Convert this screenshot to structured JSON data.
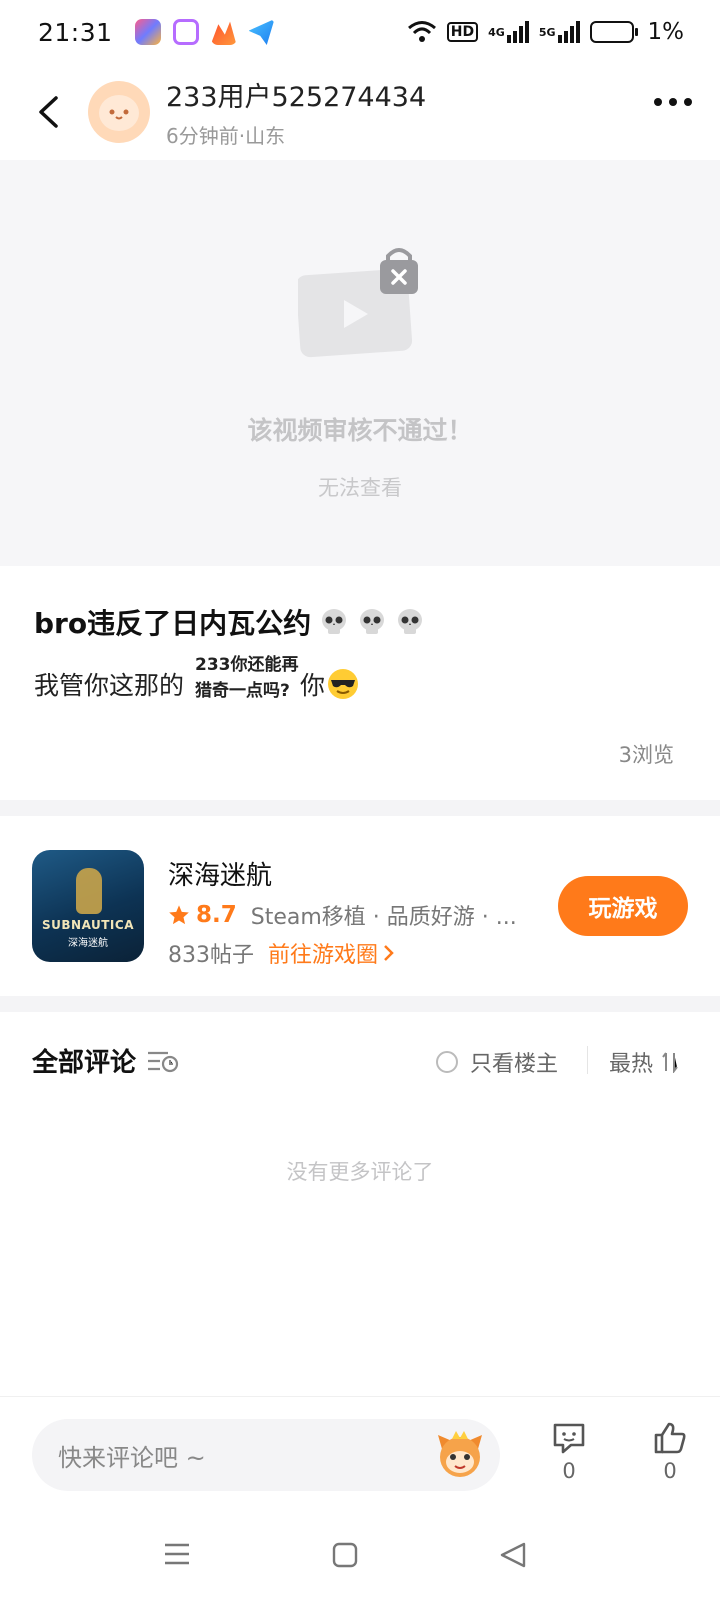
{
  "status_bar": {
    "time": "21:31",
    "battery_text": "1%",
    "app_icons": [
      "app-icon-1",
      "app-icon-2",
      "app-icon-3",
      "app-icon-4"
    ],
    "network_4g": "4G",
    "network_5g": "5G",
    "hd_label": "HD"
  },
  "header": {
    "author_name": "233用户525274434",
    "author_meta": "6分钟前·山东"
  },
  "video": {
    "blocked_title": "该视频审核不通过！",
    "blocked_subtitle": "无法查看"
  },
  "post": {
    "title": "bro违反了日内瓦公约",
    "title_emojis": [
      "skull",
      "skull",
      "skull"
    ],
    "body_start": "我管你这那的",
    "body_end": "你",
    "sticker_line1": "233你还能再",
    "sticker_line2": "猎奇一点吗?",
    "views": "3浏览"
  },
  "game": {
    "name": "深海迷航",
    "rating": "8.7",
    "tags": "Steam移植 · 品质好游 · ...",
    "posts": "833帖子",
    "link_label": "前往游戏圈",
    "play_label": "玩游戏",
    "icon_logo": "SUBNAUTICA",
    "icon_logo_cn": "深海迷航"
  },
  "comments": {
    "title": "全部评论",
    "only_op_label": "只看楼主",
    "sort_label": "最热",
    "empty_text": "没有更多评论了"
  },
  "bottom_bar": {
    "input_placeholder": "快来评论吧 ~",
    "comment_count": "0",
    "like_count": "0"
  },
  "colors": {
    "accent": "#ff7a1a",
    "muted": "#c4c4c6",
    "background_gray": "#f6f6f8"
  }
}
